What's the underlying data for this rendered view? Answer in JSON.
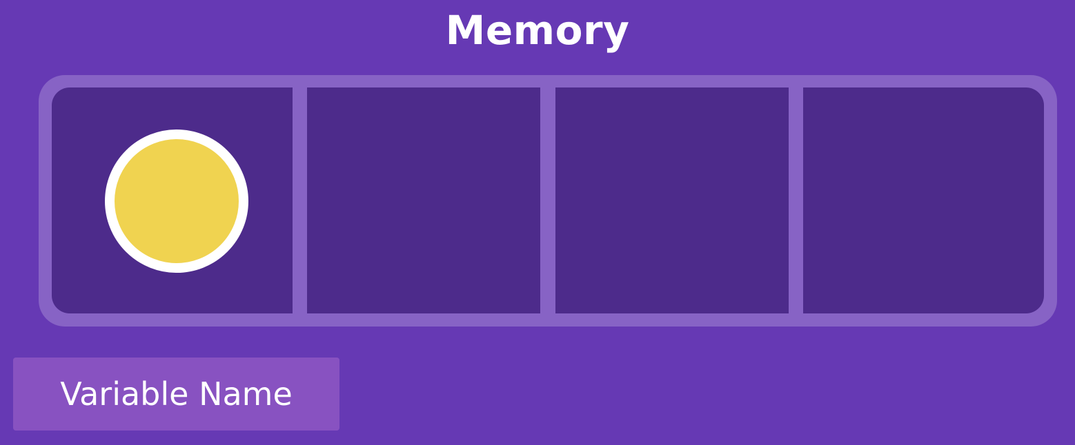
{
  "title": "Memory",
  "memory": {
    "cell_count": 4,
    "filled_cell_index": 0
  },
  "variable_label": "Variable Name",
  "colors": {
    "background": "#6639b4",
    "frame": "#8763c5",
    "cell": "#4d2b8b",
    "value": "#f0d350",
    "value_outline": "#ffffff",
    "label_box": "#8852c1",
    "text": "#ffffff"
  }
}
